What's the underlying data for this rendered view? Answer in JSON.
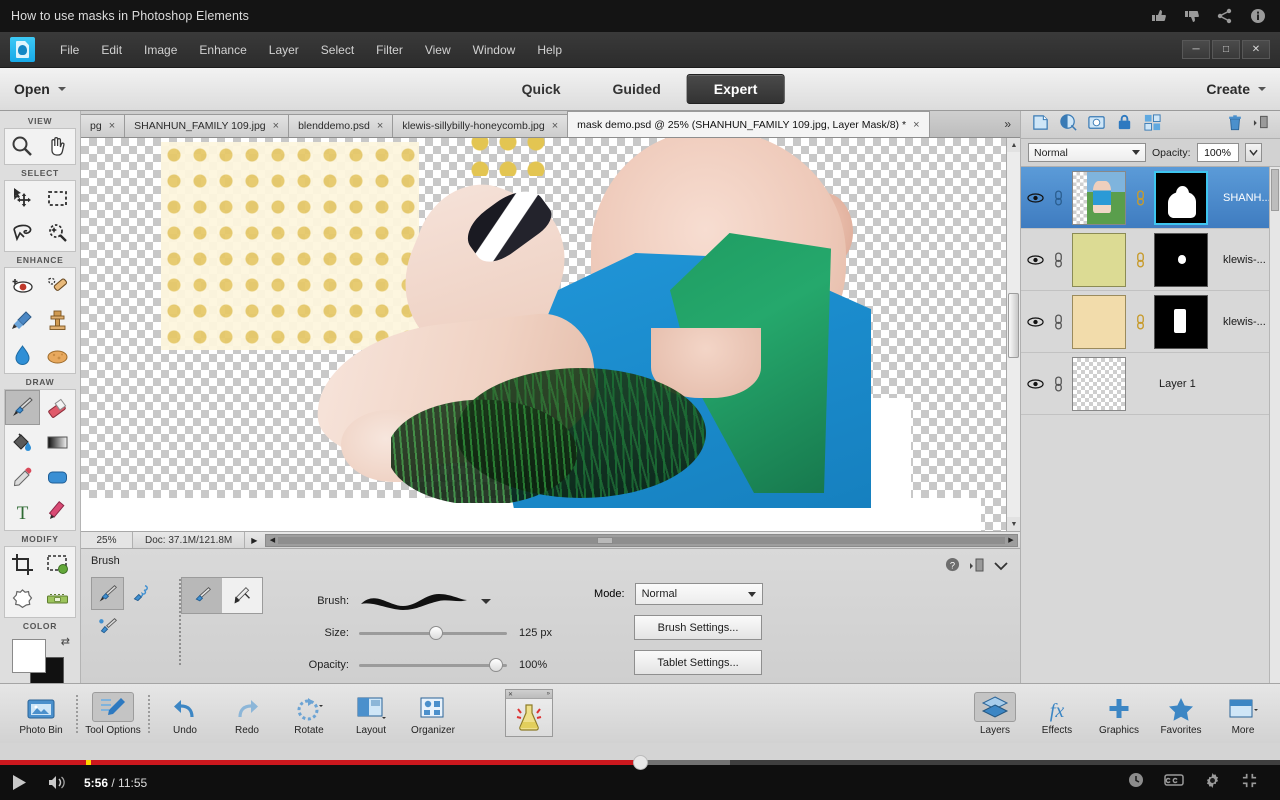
{
  "youtube": {
    "video_title": "How to use masks in Photoshop Elements",
    "top_icons": [
      "thumbs-up-icon",
      "thumbs-down-icon",
      "share-icon",
      "info-icon"
    ],
    "current_time": "5:56",
    "separator": " / ",
    "total_time": "11:55",
    "play_label": "play-button",
    "bottom_icons": [
      "watch-later-icon",
      "closed-captions-icon",
      "settings-gear-icon",
      "exit-fullscreen-icon"
    ],
    "progress_percent": 50,
    "buffer_percent": 57,
    "chapter_marker_percent": 6.7,
    "accent_color": "#cc181e",
    "chapter_color": "#ffd500"
  },
  "app": {
    "menus": [
      "File",
      "Edit",
      "Image",
      "Enhance",
      "Layer",
      "Select",
      "Filter",
      "View",
      "Window",
      "Help"
    ],
    "window_buttons": [
      "minimize",
      "maximize",
      "close"
    ],
    "open_label": "Open",
    "create_label": "Create",
    "modes": [
      {
        "label": "Quick",
        "active": false
      },
      {
        "label": "Guided",
        "active": false
      },
      {
        "label": "Expert",
        "active": true
      }
    ]
  },
  "tabs": {
    "items": [
      {
        "label": "pg",
        "active": false
      },
      {
        "label": "SHANHUN_FAMILY 109.jpg",
        "active": false
      },
      {
        "label": "blenddemo.psd",
        "active": false
      },
      {
        "label": "klewis-sillybilly-honeycomb.jpg",
        "active": false
      },
      {
        "label": "mask demo.psd @ 25% (SHANHUN_FAMILY 109.jpg, Layer Mask/8) *",
        "active": true
      }
    ],
    "overflow_label": "»",
    "close_glyph": "×"
  },
  "toolbox": {
    "groups": [
      {
        "label": "VIEW",
        "tools": [
          {
            "name": "zoom-tool",
            "active": false
          },
          {
            "name": "hand-tool",
            "active": false
          }
        ]
      },
      {
        "label": "SELECT",
        "tools": [
          {
            "name": "move-tool",
            "active": false
          },
          {
            "name": "rectangular-marquee-tool",
            "active": false
          },
          {
            "name": "lasso-tool",
            "active": false
          },
          {
            "name": "quick-selection-tool",
            "active": false
          }
        ]
      },
      {
        "label": "ENHANCE",
        "tools": [
          {
            "name": "red-eye-removal-tool",
            "active": false
          },
          {
            "name": "spot-healing-brush-tool",
            "active": false
          },
          {
            "name": "smart-brush-tool",
            "active": false
          },
          {
            "name": "clone-stamp-tool",
            "active": false
          },
          {
            "name": "blur-tool",
            "active": false
          },
          {
            "name": "sponge-tool",
            "active": false
          }
        ]
      },
      {
        "label": "DRAW",
        "tools": [
          {
            "name": "brush-tool",
            "active": true
          },
          {
            "name": "eraser-tool",
            "active": false
          },
          {
            "name": "paint-bucket-tool",
            "active": false
          },
          {
            "name": "gradient-tool",
            "active": false
          },
          {
            "name": "eyedropper-tool",
            "active": false
          },
          {
            "name": "shape-tool",
            "active": false
          },
          {
            "name": "type-tool",
            "active": false
          },
          {
            "name": "pencil-tool",
            "active": false
          }
        ]
      },
      {
        "label": "MODIFY",
        "tools": [
          {
            "name": "crop-tool",
            "active": false
          },
          {
            "name": "recompose-tool",
            "active": false
          },
          {
            "name": "cookie-cutter-tool",
            "active": false
          },
          {
            "name": "straighten-tool",
            "active": false
          }
        ]
      },
      {
        "label": "COLOR",
        "tools": []
      }
    ],
    "foreground_color": "#ffffff",
    "background_color": "#111111"
  },
  "status": {
    "zoom": "25%",
    "doc_info": "Doc: 37.1M/121.8M"
  },
  "tool_options": {
    "title": "Brush",
    "brush_label": "Brush:",
    "size_label": "Size:",
    "size_value": "125 px",
    "size_percent": 53,
    "opacity_label": "Opacity:",
    "opacity_value": "100%",
    "opacity_percent": 96,
    "mode_label": "Mode:",
    "mode_value": "Normal",
    "brush_settings_label": "Brush Settings...",
    "tablet_settings_label": "Tablet Settings...",
    "corner_icons": [
      "help-icon",
      "panel-menu-icon",
      "collapse-chevron-icon"
    ],
    "left_icons": [
      "brush-tool-icon",
      "impressionist-brush-icon",
      "color-replacement-brush-icon"
    ],
    "pair_icons": [
      "brush-mode-icon",
      "airbrush-mode-icon"
    ]
  },
  "layers": {
    "toolbar_icons": [
      "new-layer-icon",
      "adjustment-layer-icon",
      "layer-mask-icon",
      "lock-icon",
      "group-layers-icon",
      "delete-layer-icon",
      "panel-menu-icon"
    ],
    "blend_mode": "Normal",
    "opacity_label": "Opacity:",
    "opacity_value": "100%",
    "rows": [
      {
        "name": "SHANH...",
        "selected": true,
        "has_mask": true,
        "mask_active": true,
        "thumb": "photo",
        "mask": "baby-silhouette",
        "visible": true,
        "linked": true
      },
      {
        "name": "klewis-...",
        "selected": false,
        "has_mask": true,
        "mask_active": false,
        "thumb": "olive-pattern",
        "mask": "dot",
        "visible": true,
        "linked": true
      },
      {
        "name": "klewis-...",
        "selected": false,
        "has_mask": true,
        "mask_active": false,
        "thumb": "tan-pattern",
        "mask": "rect",
        "visible": true,
        "linked": true
      },
      {
        "name": "Layer 1",
        "selected": false,
        "has_mask": false,
        "mask_active": false,
        "thumb": "transparent",
        "mask": "",
        "visible": true,
        "linked": true
      }
    ]
  },
  "taskbar": {
    "left_items": [
      {
        "label": "Photo Bin",
        "icon": "photo-bin-icon",
        "active": false
      },
      {
        "label": "Tool Options",
        "icon": "tool-options-icon",
        "active": true
      },
      {
        "label": "Undo",
        "icon": "undo-arrow-icon",
        "active": false
      },
      {
        "label": "Redo",
        "icon": "redo-arrow-icon",
        "active": false
      },
      {
        "label": "Rotate",
        "icon": "rotate-icon",
        "active": false
      },
      {
        "label": "Layout",
        "icon": "layout-icon",
        "active": false
      },
      {
        "label": "Organizer",
        "icon": "organizer-icon",
        "active": false
      }
    ],
    "right_items": [
      {
        "label": "Layers",
        "icon": "layers-stack-icon",
        "active": true
      },
      {
        "label": "Effects",
        "icon": "effects-fx-icon",
        "active": false
      },
      {
        "label": "Graphics",
        "icon": "graphics-plus-icon",
        "active": false
      },
      {
        "label": "Favorites",
        "icon": "favorites-star-icon",
        "active": false
      },
      {
        "label": "More",
        "icon": "more-panel-icon",
        "active": false
      }
    ]
  }
}
